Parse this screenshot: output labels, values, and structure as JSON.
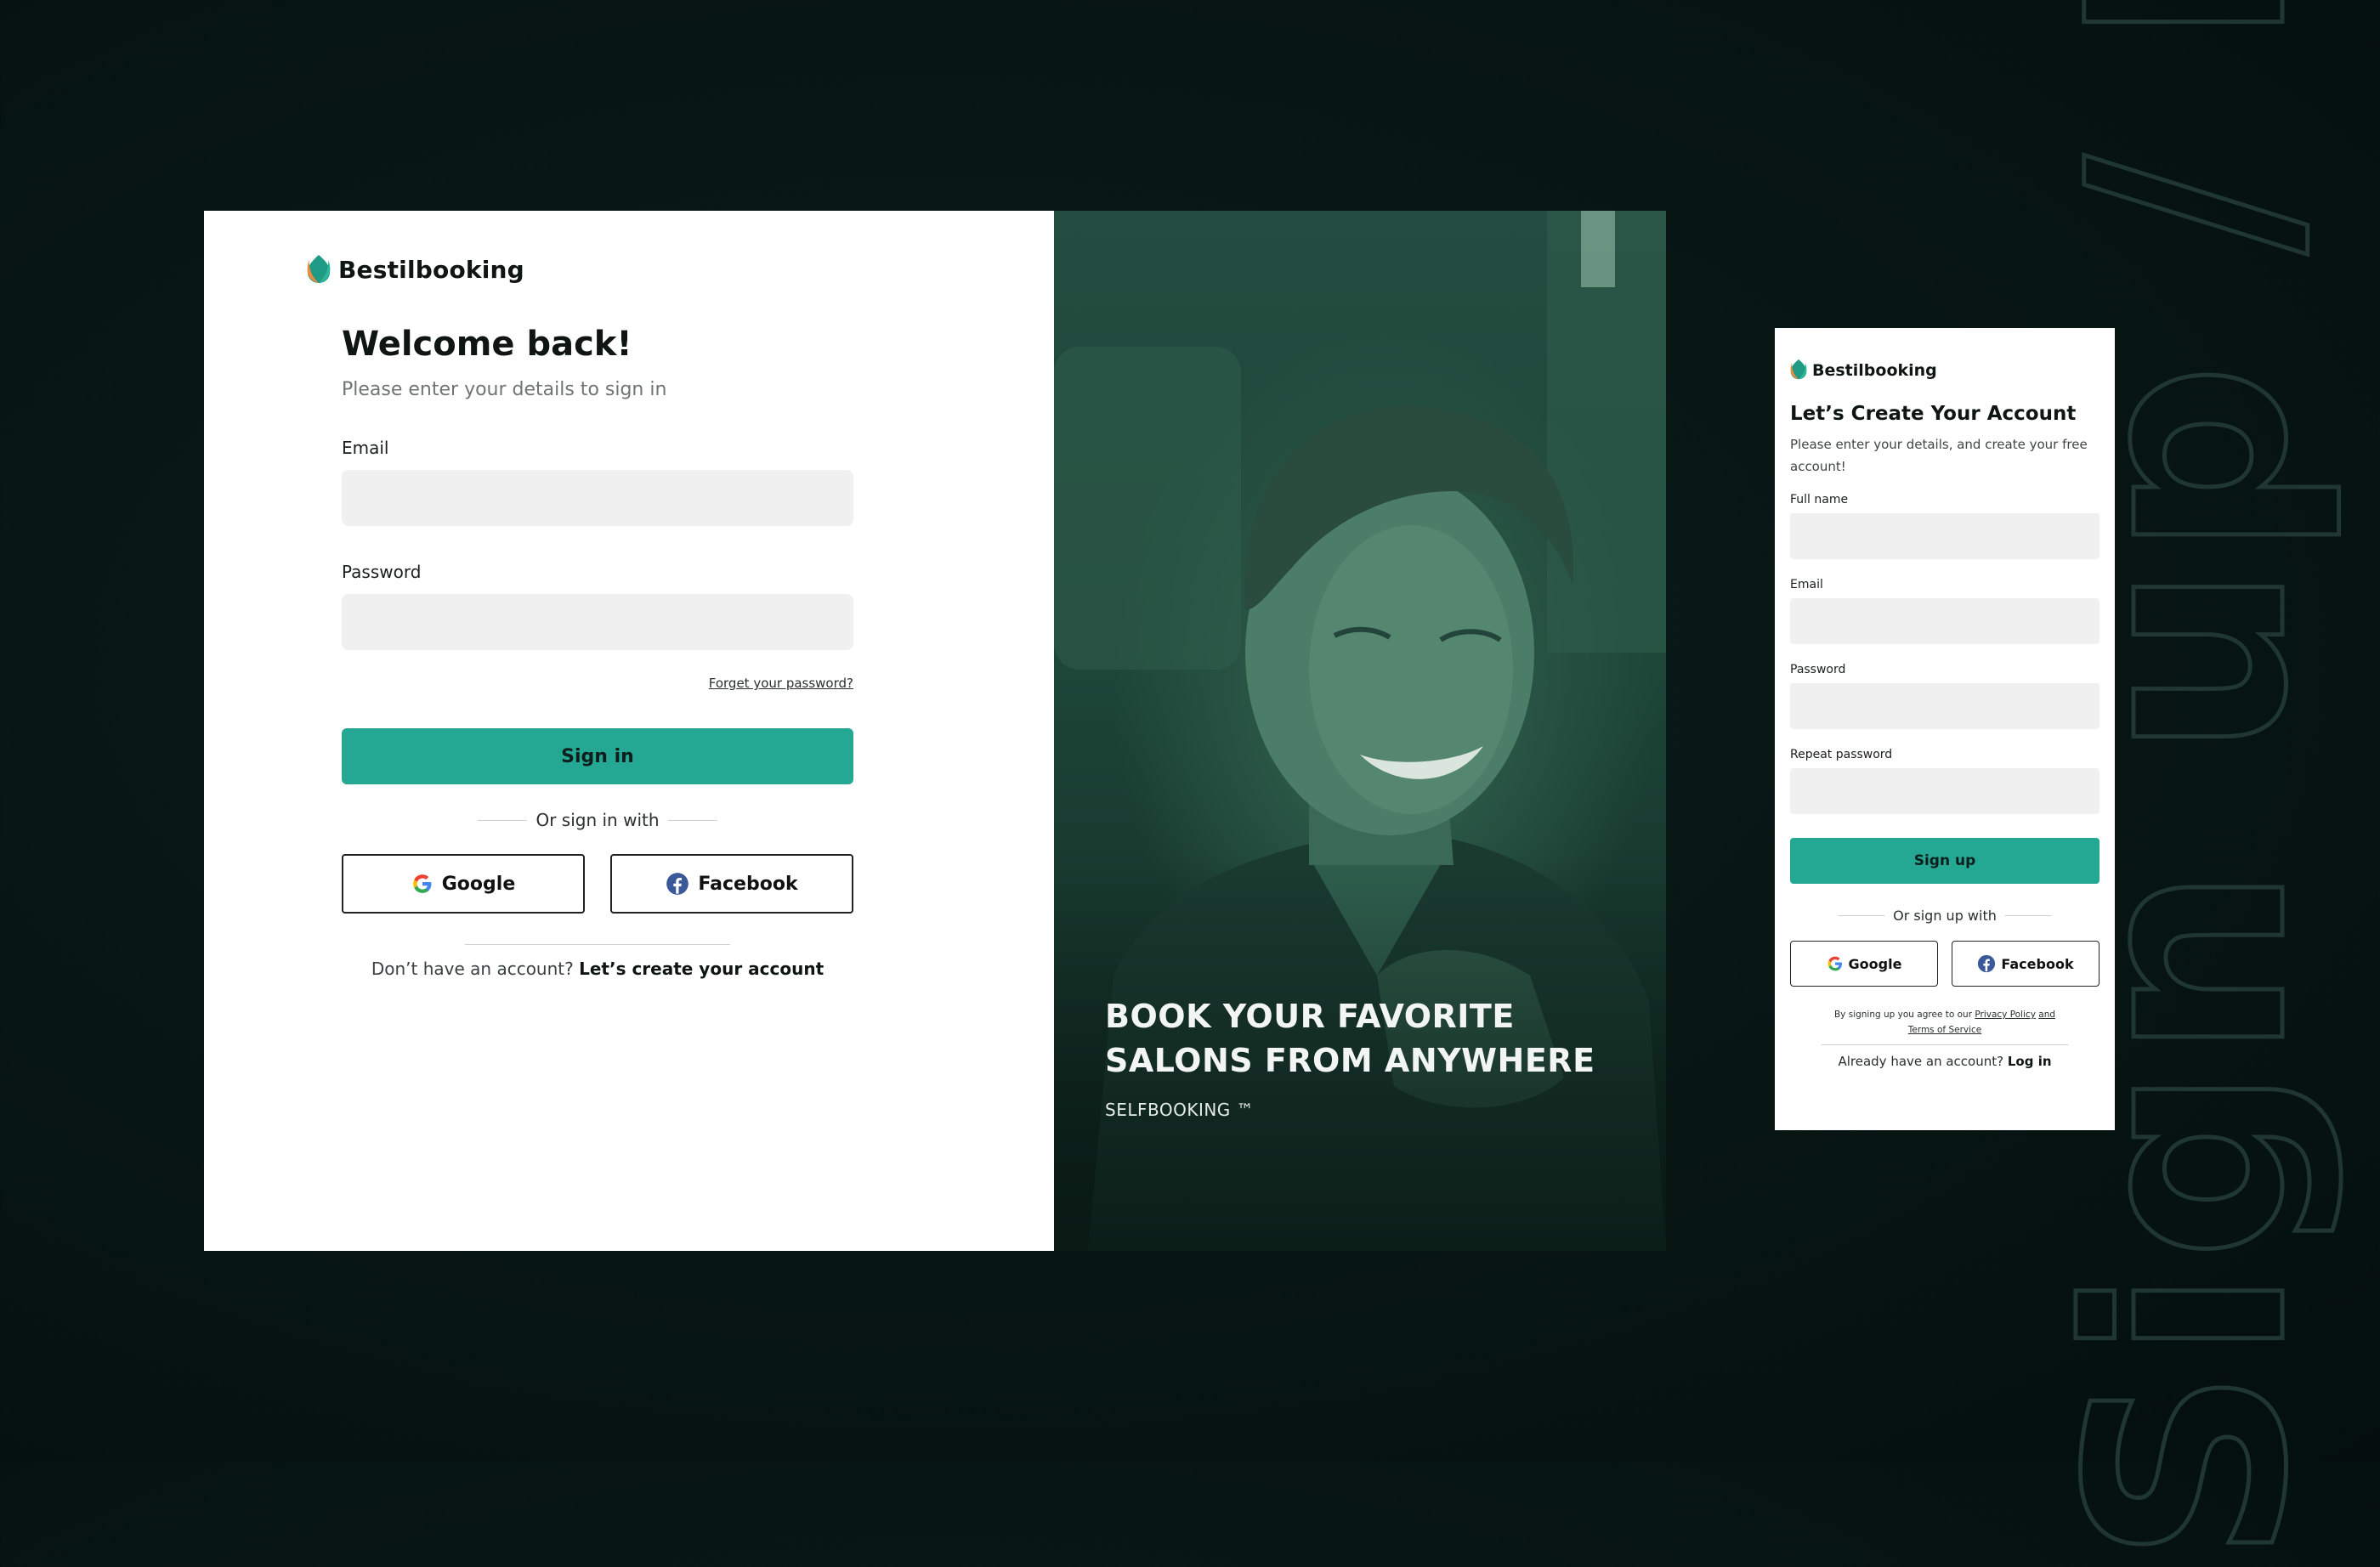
{
  "background_side_text": "Sign up / Log in",
  "colors": {
    "accent": "#24a893",
    "background": "#071513",
    "hero_tint": "#1f4a3d"
  },
  "login": {
    "brand_name": "Bestilbooking",
    "brand_icon": "flame-leaf-logo",
    "title": "Welcome back!",
    "subtitle": "Please enter your details to sign in",
    "email_label": "Email",
    "email_value": "",
    "password_label": "Password",
    "password_value": "",
    "forgot_link": "Forget your password?",
    "submit_label": "Sign in",
    "divider_text": "Or sign in with",
    "google_label": "Google",
    "facebook_label": "Facebook",
    "footer_text": "Don’t have an account?",
    "footer_link": "Let’s create your account"
  },
  "hero": {
    "headline": "BOOK YOUR FAVORITE SALONS FROM ANYWHERE",
    "tagline": "SELFBOOKING ™"
  },
  "signup": {
    "brand_name": "Bestilbooking",
    "title": "Let’s Create Your Account",
    "subtitle": "Please enter your details, and create your free account!",
    "fullname_label": "Full name",
    "email_label": "Email",
    "password_label": "Password",
    "repeat_password_label": "Repeat password",
    "submit_label": "Sign up",
    "divider_text": "Or sign up with",
    "google_label": "Google",
    "facebook_label": "Facebook",
    "terms_prefix": "By signing up you agree to our",
    "privacy_link": "Privacy Policy",
    "and_text": "and",
    "terms_link": "Terms of Service",
    "footer_text": "Already have an account?",
    "footer_link": "Log in"
  }
}
